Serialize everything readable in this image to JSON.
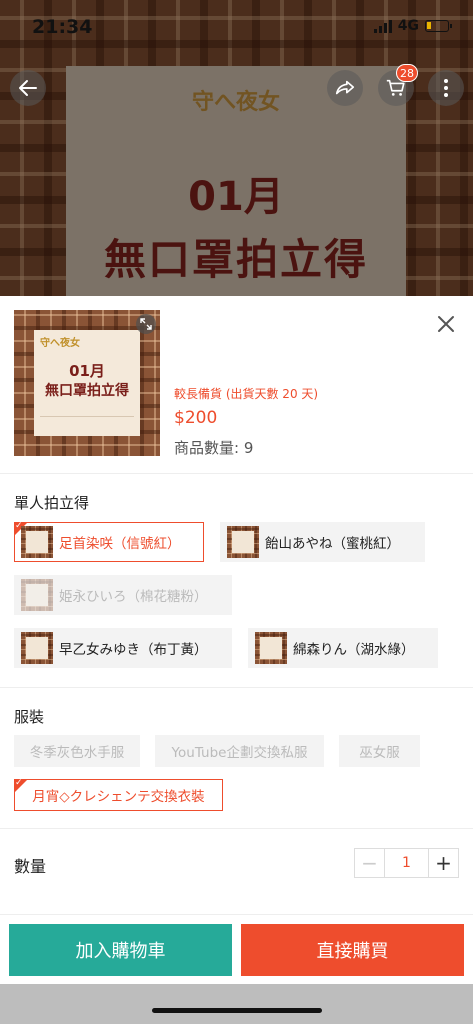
{
  "status_bar": {
    "time": "21:34",
    "network": "4G"
  },
  "background": {
    "logo_text": "守へ夜女",
    "title_line1": "01月",
    "title_line2": "無口罩拍立得"
  },
  "top_nav": {
    "cart_count": "28"
  },
  "product": {
    "thumb_line1": "01月",
    "thumb_line2": "無口罩拍立得",
    "thumb_logo": "守へ夜女",
    "stock_note": "較長備貨 (出貨天數 20 天)",
    "price": "$200",
    "quantity_available": "商品數量: 9"
  },
  "variation1": {
    "title": "單人拍立得",
    "options": [
      {
        "label": "足首染咲（信號紅）",
        "state": "selected"
      },
      {
        "label": "飴山あやね（蜜桃紅）",
        "state": "normal"
      },
      {
        "label": "姫永ひいろ（棉花糖粉）",
        "state": "disabled"
      },
      {
        "label": "早乙女みゆき（布丁黃）",
        "state": "normal"
      },
      {
        "label": "綿森りん（湖水綠）",
        "state": "normal"
      }
    ]
  },
  "variation2": {
    "title": "服裝",
    "options": [
      {
        "label": "冬季灰色水手服",
        "state": "disabled"
      },
      {
        "label": "YouTube企劃交換私服",
        "state": "disabled"
      },
      {
        "label": "巫女服",
        "state": "disabled"
      },
      {
        "label": "月宵◇クレシェンテ交換衣裝",
        "state": "selected"
      }
    ]
  },
  "quantity": {
    "label": "數量",
    "value": "1",
    "minus": "−",
    "plus": "+"
  },
  "footer": {
    "add_to_cart": "加入購物車",
    "buy_now": "直接購買"
  },
  "colors": {
    "accent": "#ee4d2d",
    "cart_button": "#26aa99"
  }
}
